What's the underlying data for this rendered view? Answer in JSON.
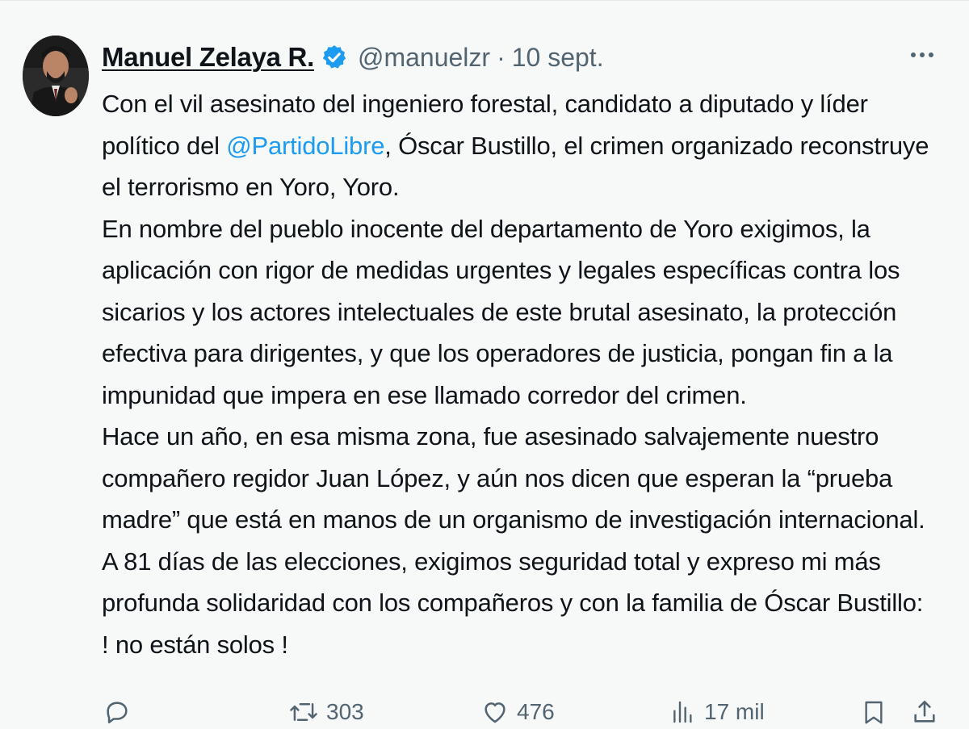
{
  "tweet": {
    "author": {
      "name": "Manuel Zelaya R.",
      "handle": "@manuelzr",
      "separator": "·",
      "date": "10 sept."
    },
    "body": {
      "l1": "Con el vil asesinato del ingeniero forestal, candidato a diputado y líder",
      "l2_pre": "político del ",
      "l2_mention": "@PartidoLibre",
      "l2_post": ", Óscar Bustillo, el crimen organizado reconstruye",
      "l3": "el terrorismo en Yoro, Yoro.",
      "l4": "En nombre del pueblo inocente del departamento de Yoro exigimos, la",
      "l5": "aplicación con rigor de medidas urgentes y legales específicas contra los",
      "l6": "sicarios y los actores intelectuales de este brutal asesinato, la protección",
      "l7": "efectiva para dirigentes, y que los operadores de justicia, pongan fin a la",
      "l8": "impunidad que impera en ese llamado corredor del crimen.",
      "l9": "Hace un año, en esa misma zona, fue asesinado salvajemente nuestro",
      "l10": "compañero regidor Juan López, y aún nos dicen que esperan la “prueba",
      "l11": "madre” que está en manos de un organismo de investigación internacional.",
      "l12": "A 81 días de las elecciones, exigimos seguridad total y expreso mi más",
      "l13": "profunda solidaridad con los compañeros y con la familia de Óscar Bustillo:",
      "l14": "! no están solos !"
    },
    "stats": {
      "retweets": "303",
      "likes": "476",
      "views": "17 mil"
    }
  },
  "icons": {
    "verified": "verified-badge-icon",
    "more": "more-dots-icon",
    "reply": "reply-icon",
    "retweet": "retweet-icon",
    "like": "heart-icon",
    "views": "views-chart-icon",
    "bookmark": "bookmark-icon",
    "share": "share-icon"
  },
  "colors": {
    "text": "#0f1419",
    "secondary": "#536471",
    "accent": "#1d9bf0",
    "background": "#f7f9f9"
  }
}
